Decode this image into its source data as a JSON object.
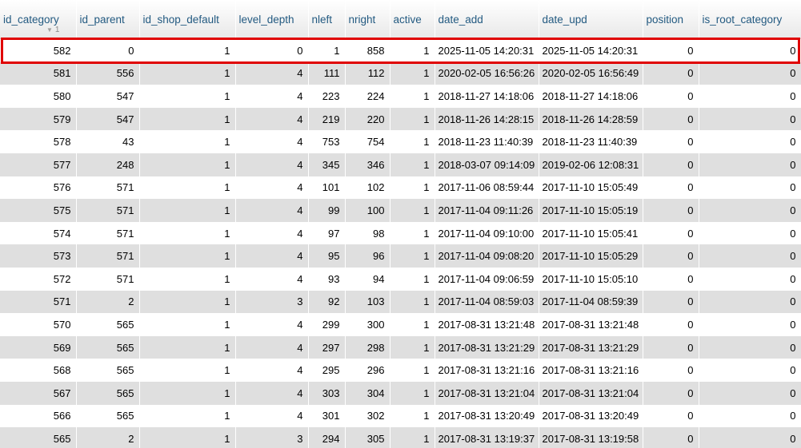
{
  "table": {
    "columns": [
      {
        "label": "id_category",
        "sort_indicator": "1"
      },
      {
        "label": "id_parent"
      },
      {
        "label": "id_shop_default"
      },
      {
        "label": "level_depth"
      },
      {
        "label": "nleft"
      },
      {
        "label": "nright"
      },
      {
        "label": "active"
      },
      {
        "label": "date_add"
      },
      {
        "label": "date_upd"
      },
      {
        "label": "position"
      },
      {
        "label": "is_root_category"
      }
    ],
    "rows": [
      [
        "582",
        "0",
        "1",
        "0",
        "1",
        "858",
        "1",
        "2025-11-05 14:20:31",
        "2025-11-05 14:20:31",
        "0",
        "0"
      ],
      [
        "581",
        "556",
        "1",
        "4",
        "111",
        "112",
        "1",
        "2020-02-05 16:56:26",
        "2020-02-05 16:56:49",
        "0",
        "0"
      ],
      [
        "580",
        "547",
        "1",
        "4",
        "223",
        "224",
        "1",
        "2018-11-27 14:18:06",
        "2018-11-27 14:18:06",
        "0",
        "0"
      ],
      [
        "579",
        "547",
        "1",
        "4",
        "219",
        "220",
        "1",
        "2018-11-26 14:28:15",
        "2018-11-26 14:28:59",
        "0",
        "0"
      ],
      [
        "578",
        "43",
        "1",
        "4",
        "753",
        "754",
        "1",
        "2018-11-23 11:40:39",
        "2018-11-23 11:40:39",
        "0",
        "0"
      ],
      [
        "577",
        "248",
        "1",
        "4",
        "345",
        "346",
        "1",
        "2018-03-07 09:14:09",
        "2019-02-06 12:08:31",
        "0",
        "0"
      ],
      [
        "576",
        "571",
        "1",
        "4",
        "101",
        "102",
        "1",
        "2017-11-06 08:59:44",
        "2017-11-10 15:05:49",
        "0",
        "0"
      ],
      [
        "575",
        "571",
        "1",
        "4",
        "99",
        "100",
        "1",
        "2017-11-04 09:11:26",
        "2017-11-10 15:05:19",
        "0",
        "0"
      ],
      [
        "574",
        "571",
        "1",
        "4",
        "97",
        "98",
        "1",
        "2017-11-04 09:10:00",
        "2017-11-10 15:05:41",
        "0",
        "0"
      ],
      [
        "573",
        "571",
        "1",
        "4",
        "95",
        "96",
        "1",
        "2017-11-04 09:08:20",
        "2017-11-10 15:05:29",
        "0",
        "0"
      ],
      [
        "572",
        "571",
        "1",
        "4",
        "93",
        "94",
        "1",
        "2017-11-04 09:06:59",
        "2017-11-10 15:05:10",
        "0",
        "0"
      ],
      [
        "571",
        "2",
        "1",
        "3",
        "92",
        "103",
        "1",
        "2017-11-04 08:59:03",
        "2017-11-04 08:59:39",
        "0",
        "0"
      ],
      [
        "570",
        "565",
        "1",
        "4",
        "299",
        "300",
        "1",
        "2017-08-31 13:21:48",
        "2017-08-31 13:21:48",
        "0",
        "0"
      ],
      [
        "569",
        "565",
        "1",
        "4",
        "297",
        "298",
        "1",
        "2017-08-31 13:21:29",
        "2017-08-31 13:21:29",
        "0",
        "0"
      ],
      [
        "568",
        "565",
        "1",
        "4",
        "295",
        "296",
        "1",
        "2017-08-31 13:21:16",
        "2017-08-31 13:21:16",
        "0",
        "0"
      ],
      [
        "567",
        "565",
        "1",
        "4",
        "303",
        "304",
        "1",
        "2017-08-31 13:21:04",
        "2017-08-31 13:21:04",
        "0",
        "0"
      ],
      [
        "566",
        "565",
        "1",
        "4",
        "301",
        "302",
        "1",
        "2017-08-31 13:20:49",
        "2017-08-31 13:20:49",
        "0",
        "0"
      ],
      [
        "565",
        "2",
        "1",
        "3",
        "294",
        "305",
        "1",
        "2017-08-31 13:19:37",
        "2017-08-31 13:19:58",
        "0",
        "0"
      ]
    ],
    "highlighted_row": 0
  },
  "colors": {
    "header_text": "#235a81",
    "row_alt": "#dfdfdf",
    "highlight": "#e00000"
  }
}
